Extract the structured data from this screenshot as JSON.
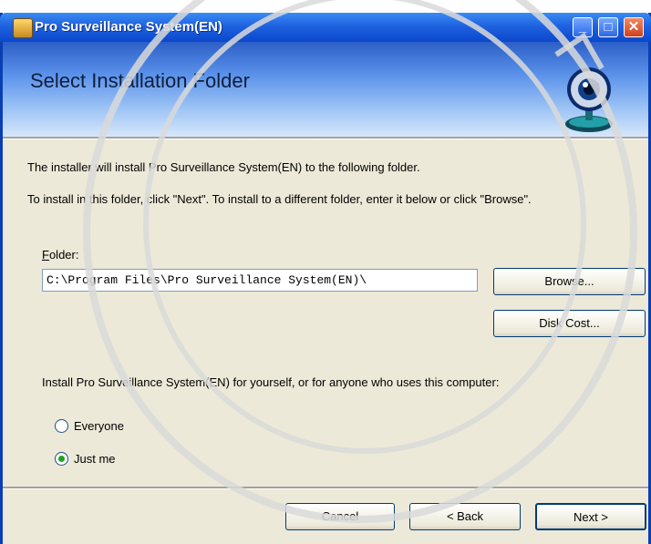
{
  "window": {
    "title": "Pro Surveillance System(EN)"
  },
  "banner": {
    "heading": "Select Installation Folder"
  },
  "body": {
    "line1": "The installer will install Pro Surveillance System(EN) to the following folder.",
    "line2": "To install in this folder, click \"Next\". To install to a different folder, enter it below or click \"Browse\"."
  },
  "folder": {
    "label_first": "F",
    "label_rest": "older:",
    "value": "C:\\Program Files\\Pro Surveillance System(EN)\\"
  },
  "buttons": {
    "browse": "Browse...",
    "disk_cost": "Disk Cost...",
    "cancel": "Cancel",
    "back": "< Back",
    "next": "Next >"
  },
  "install_for": {
    "question": "Install Pro Surveillance System(EN) for yourself, or for anyone who uses this computer:",
    "options": [
      {
        "label": "Everyone",
        "selected": false
      },
      {
        "label": "Just me",
        "selected": true
      }
    ]
  },
  "icons": {
    "app": "installer-icon",
    "logo": "webcam-icon",
    "minimize": "minimize-icon",
    "maximize": "maximize-icon",
    "close": "close-icon"
  }
}
